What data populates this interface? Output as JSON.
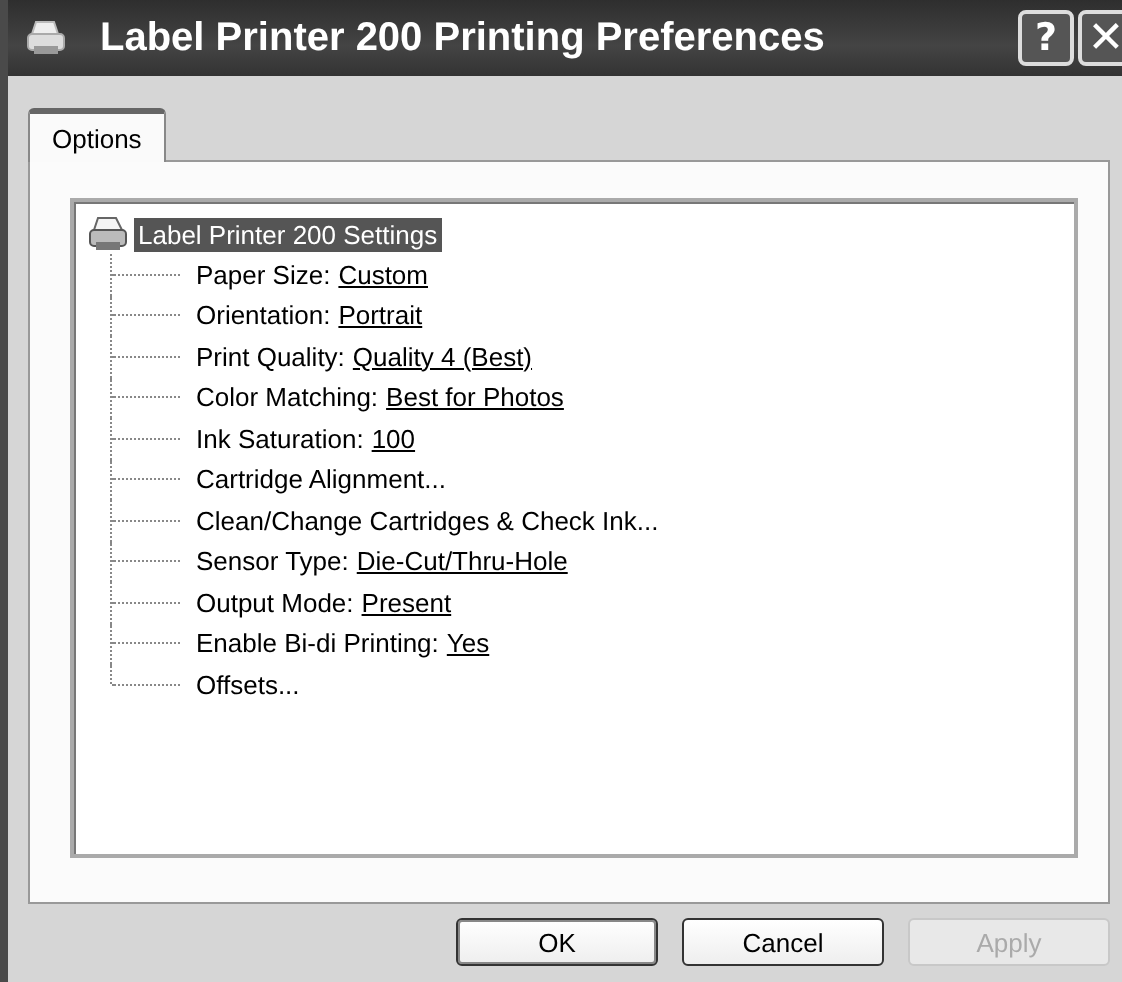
{
  "window": {
    "title": "Label Printer 200 Printing Preferences"
  },
  "title_buttons": [
    {
      "kind": "help",
      "label": "?"
    },
    {
      "kind": "close",
      "label": "✕"
    }
  ],
  "tabs": [
    {
      "label": "Options",
      "selected": true
    }
  ],
  "tree": {
    "label": "Label Printer 200 Settings",
    "selected": true,
    "children": [
      {
        "label": "Paper Size:",
        "value": "Custom"
      },
      {
        "label": "Orientation:",
        "value": "Portrait"
      },
      {
        "label": "Print Quality:",
        "value": "Quality 4 (Best)"
      },
      {
        "label": "Color Matching:",
        "value": "Best for Photos"
      },
      {
        "label": "Ink Saturation:",
        "value": "100"
      },
      {
        "label": "Cartridge Alignment..."
      },
      {
        "label": "Clean/Change Cartridges & Check Ink..."
      },
      {
        "label": "Sensor Type:",
        "value": "Die-Cut/Thru-Hole"
      },
      {
        "label": "Output Mode:",
        "value": "Present"
      },
      {
        "label": "Enable Bi-di Printing:",
        "value": "Yes"
      },
      {
        "label": "Offsets..."
      }
    ]
  },
  "buttons": [
    {
      "label": "OK",
      "disabled": false,
      "default": true
    },
    {
      "label": "Cancel",
      "disabled": false,
      "default": false
    },
    {
      "label": "Apply",
      "disabled": true,
      "default": false
    }
  ]
}
